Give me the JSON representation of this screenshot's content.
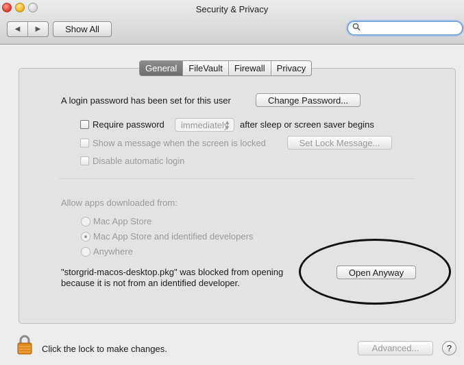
{
  "window": {
    "title": "Security & Privacy"
  },
  "toolbar": {
    "back_icon": "◀",
    "forward_icon": "▶",
    "show_all": "Show All",
    "search_icon": "magnifier-icon",
    "search_value": ""
  },
  "tabs": [
    {
      "label": "General",
      "selected": true
    },
    {
      "label": "FileVault",
      "selected": false
    },
    {
      "label": "Firewall",
      "selected": false
    },
    {
      "label": "Privacy",
      "selected": false
    }
  ],
  "general": {
    "login_text": "A login password has been set for this user",
    "change_password": "Change Password...",
    "require_password_label": "Require password",
    "require_password_value": "immediately",
    "require_password_suffix": "after sleep or screen saver begins",
    "show_message_label": "Show a message when the screen is locked",
    "set_lock_message": "Set Lock Message...",
    "disable_auto_login": "Disable automatic login",
    "allow_apps_label": "Allow apps downloaded from:",
    "options": [
      "Mac App Store",
      "Mac App Store and identified developers",
      "Anywhere"
    ],
    "selected_option": 1,
    "blocked_line1": "\"storgrid-macos-desktop.pkg\" was blocked from opening",
    "blocked_line2": "because it is not from an identified developer.",
    "open_anyway": "Open Anyway"
  },
  "footer": {
    "lock_text": "Click the lock to make changes.",
    "advanced": "Advanced...",
    "help": "?"
  }
}
